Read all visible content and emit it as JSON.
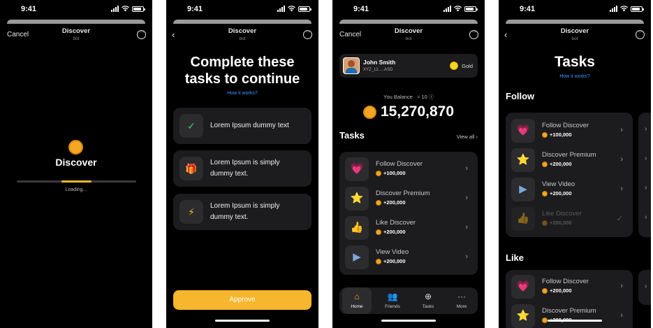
{
  "status": {
    "time": "9:41"
  },
  "colors": {
    "accent": "#f6b62d",
    "coin": "#f6a623",
    "card": "#1c1c1e",
    "link": "#3e95ff"
  },
  "screen1": {
    "nav": {
      "cancel": "Cancel",
      "title": "Discover",
      "subtitle": "bot"
    },
    "app_name": "Discover",
    "loading": "Loading...",
    "progress": 0.25
  },
  "screen2": {
    "nav": {
      "title": "Discover",
      "subtitle": "bot"
    },
    "headline_line1": "Complete these",
    "headline_line2": "tasks to continue",
    "how": "How it works?",
    "tasks": [
      {
        "icon": "check-icon",
        "glyph": "✓",
        "line1": "Lorem Ipsum dummy text",
        "line2": ""
      },
      {
        "icon": "gift-icon",
        "glyph": "🎁",
        "line1": "Lorem Ipsum is simply",
        "line2": "dummy text."
      },
      {
        "icon": "lightning-icon",
        "glyph": "⚡",
        "line1": "Lorem Ipsum is simply",
        "line2": "dummy text."
      }
    ],
    "approve": "Approve"
  },
  "screen3": {
    "nav": {
      "cancel": "Cancel",
      "title": "Discover",
      "subtitle": "bot"
    },
    "user": {
      "name": "John Smith",
      "id": "XYZ_12.....ASD",
      "level": "Gold"
    },
    "balance_label": "You Balance",
    "balance_small": "≈ 10",
    "balance": "15,270,870",
    "tasks_title": "Tasks",
    "view_all": "View all",
    "tasks": [
      {
        "icon": "heart-icon",
        "glyph": "💗",
        "title": "Follow Discover",
        "points": "+100,000"
      },
      {
        "icon": "star-icon",
        "glyph": "⭐",
        "title": "Discover Premium",
        "points": "+200,000"
      },
      {
        "icon": "thumbs-up-icon",
        "glyph": "👍",
        "title": "Like Discover",
        "points": "+200,000"
      },
      {
        "icon": "play-icon",
        "glyph": "▶",
        "title": "View Video",
        "points": "+200,000"
      }
    ],
    "tabs": [
      {
        "icon": "home-icon",
        "glyph": "⌂",
        "label": "Home"
      },
      {
        "icon": "friends-icon",
        "glyph": "👥",
        "label": "Friends"
      },
      {
        "icon": "tasks-icon",
        "glyph": "⊕",
        "label": "Tasks"
      },
      {
        "icon": "more-icon",
        "glyph": "···",
        "label": "More"
      }
    ]
  },
  "screen4": {
    "nav": {
      "title": "Discover",
      "subtitle": "bot"
    },
    "headline": "Tasks",
    "how": "How it works?",
    "follow_title": "Follow",
    "follow": [
      {
        "icon": "heart-icon",
        "glyph": "💗",
        "title": "Follow Discover",
        "points": "+100,000"
      },
      {
        "icon": "star-icon",
        "glyph": "⭐",
        "title": "Discover Premium",
        "points": "+200,000"
      },
      {
        "icon": "play-icon",
        "glyph": "▶",
        "title": "View Video",
        "points": "+200,000"
      },
      {
        "icon": "thumbs-up-icon",
        "glyph": "👍",
        "title": "Like Discover",
        "points": "+200,000"
      }
    ],
    "like_title": "Like",
    "like": [
      {
        "icon": "heart-icon",
        "glyph": "💗",
        "title": "Follow Discover",
        "points": "+200,000"
      },
      {
        "icon": "star-icon",
        "glyph": "⭐",
        "title": "Discover Premium",
        "points": "+200,000"
      }
    ]
  }
}
